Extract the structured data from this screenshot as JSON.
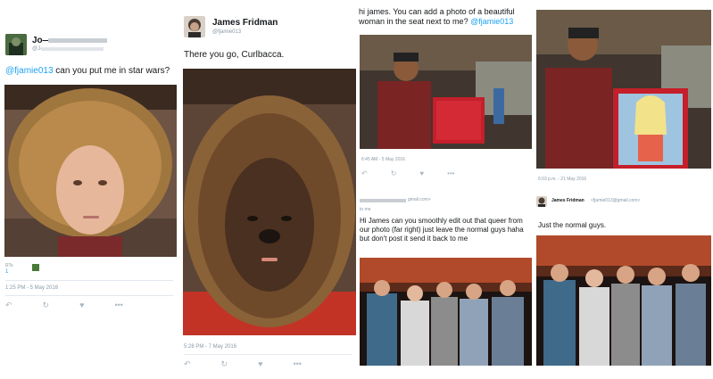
{
  "panel1": {
    "name": "Jo—",
    "handle": "@J—",
    "mention": "@fjamie013",
    "text": " can you put me in star wars?",
    "stat_label": "RTs",
    "stat_value": "1",
    "timestamp": "1:25 PM - 5 May 2016"
  },
  "panel2": {
    "name": "James Fridman",
    "handle": "@fjamie013",
    "text": "There you go, Curlbacca.",
    "timestamp": "5:28 PM - 7 May 2016"
  },
  "panel3": {
    "text_line1": "hi james. You can add a photo of a beautiful",
    "text_line2": "woman in the seat next to me? ",
    "mention": "@fjamie013",
    "timestamp_left": "6:45 AM - 5 May 2016",
    "timestamp_right": "6:03 p.m. - 21 May 2016"
  },
  "panel4": {
    "email_from": "gmail.com>",
    "to_me": "to me",
    "text": "Hi James can you smoothly edit out that queer from our photo (far right) just leave the normal guys haha but don't post it send it back to me",
    "reply_name": "James Fridman",
    "reply_email": "<fjamie013@gmail.com>",
    "reply_text": "Just the normal guys."
  },
  "icons": {
    "reply": "reply-icon",
    "retweet": "retweet-icon",
    "like": "heart-icon",
    "more": "more-icon"
  }
}
